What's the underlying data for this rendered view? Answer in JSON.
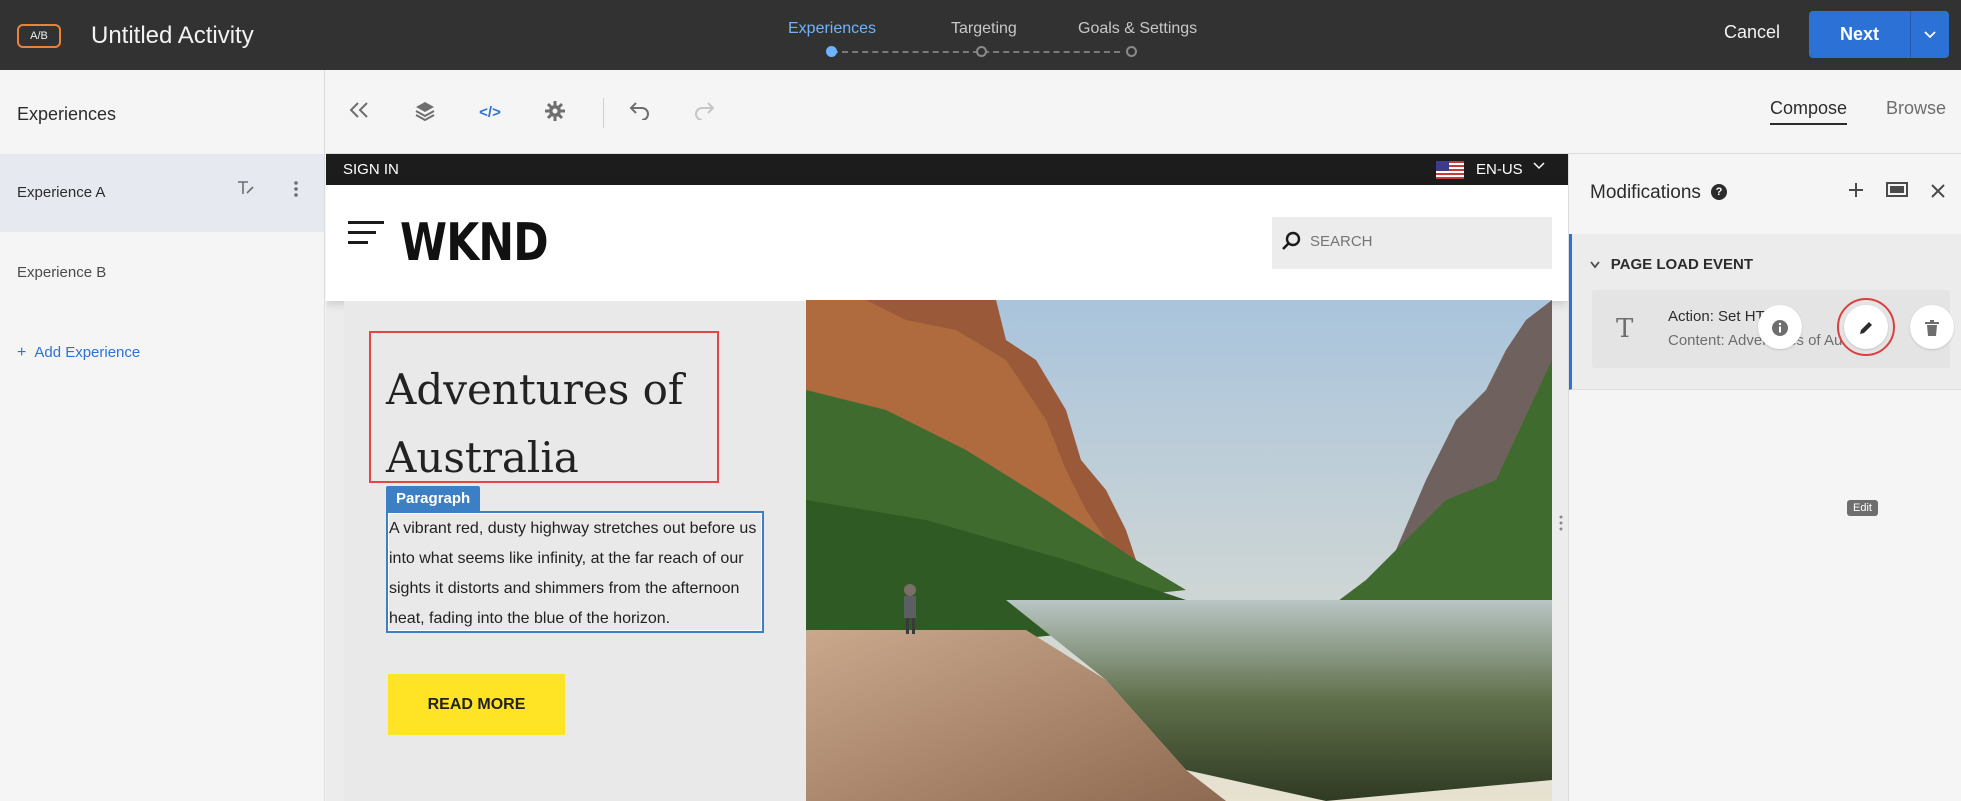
{
  "topbar": {
    "badge": "A/B",
    "activity_title": "Untitled Activity",
    "steps": [
      "Experiences",
      "Targeting",
      "Goals & Settings"
    ],
    "cancel_label": "Cancel",
    "next_label": "Next",
    "next_caret": "⌄"
  },
  "left": {
    "title": "Experiences",
    "experiences": [
      {
        "label": "Experience A",
        "selected": true
      },
      {
        "label": "Experience B",
        "selected": false
      }
    ],
    "add_label": "Add Experience",
    "add_plus": "+"
  },
  "toolbar": {
    "icons": [
      "collapse-icon",
      "layers-icon",
      "code-icon",
      "gear-icon",
      "undo-icon",
      "redo-icon"
    ],
    "code_glyph": "</>",
    "compose_label": "Compose",
    "browse_label": "Browse"
  },
  "site": {
    "sign_in": "SIGN IN",
    "locale": "EN-US",
    "logo": "WKND",
    "search_placeholder": "SEARCH",
    "heading": "Adventures of Australia",
    "paragraph_tag": "Paragraph",
    "paragraph": "A vibrant red, dusty highway stretches out before us into what seems like infinity, at the far reach of our sights it distorts and shimmers from the afternoon heat, fading into the blue of the horizon.",
    "read_more": "READ MORE"
  },
  "right": {
    "title": "Modifications",
    "help_glyph": "?",
    "event_title": "PAGE LOAD EVENT",
    "mod_type_glyph": "T",
    "action_text": "Action: Set HTML",
    "content_text": "Content: Adventures of Au",
    "tooltip": "Edit"
  },
  "colors": {
    "accent": "#2c72d6",
    "active_step": "#6fb3ff",
    "read_more_bg": "#ffe426",
    "selection_red": "#e04848",
    "selection_blue": "#3d7fc4"
  }
}
